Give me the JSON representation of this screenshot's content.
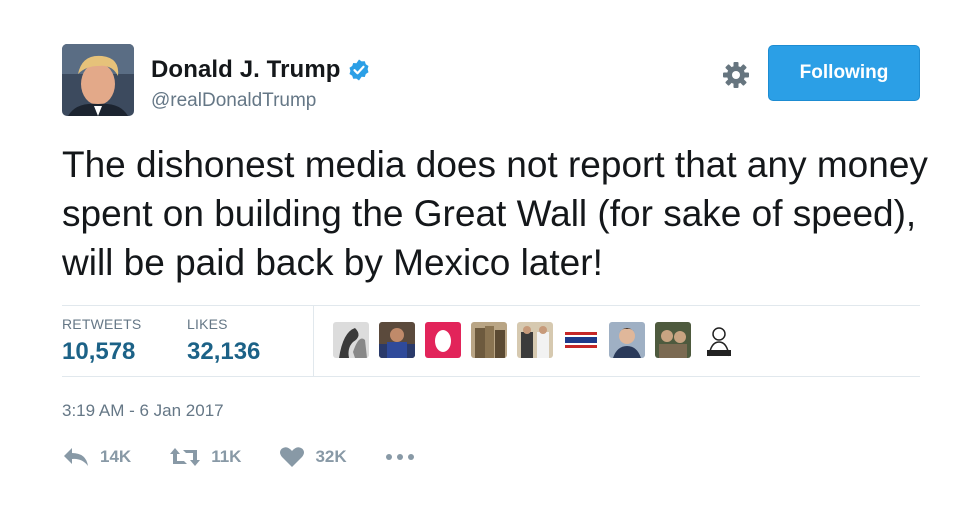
{
  "user": {
    "name": "Donald J. Trump",
    "handle": "@realDonaldTrump",
    "verified_icon": "verified-badge-icon",
    "avatar": "profile-photo"
  },
  "header": {
    "settings_icon": "gear-icon",
    "follow_label": "Following"
  },
  "tweet": {
    "text": "The dishonest media does not report that any money spent on building the Great Wall (for sake of speed), will be paid back by Mexico later!"
  },
  "stats": {
    "retweets_label": "RETWEETS",
    "retweets_value": "10,578",
    "likes_label": "LIKES",
    "likes_value": "32,136"
  },
  "likers": [
    "liker-avatar-1",
    "liker-avatar-2",
    "liker-avatar-3",
    "liker-avatar-4",
    "liker-avatar-5",
    "liker-avatar-6",
    "liker-avatar-7",
    "liker-avatar-8",
    "liker-avatar-9"
  ],
  "timestamp": "3:19 AM - 6 Jan 2017",
  "actions": {
    "reply_count": "14K",
    "retweet_count": "11K",
    "like_count": "32K",
    "more_icon": "more-dots-icon"
  },
  "colors": {
    "accent": "#2b9fe6",
    "stat_value": "#1c6287",
    "muted": "#657786",
    "icon": "#8899a6"
  }
}
